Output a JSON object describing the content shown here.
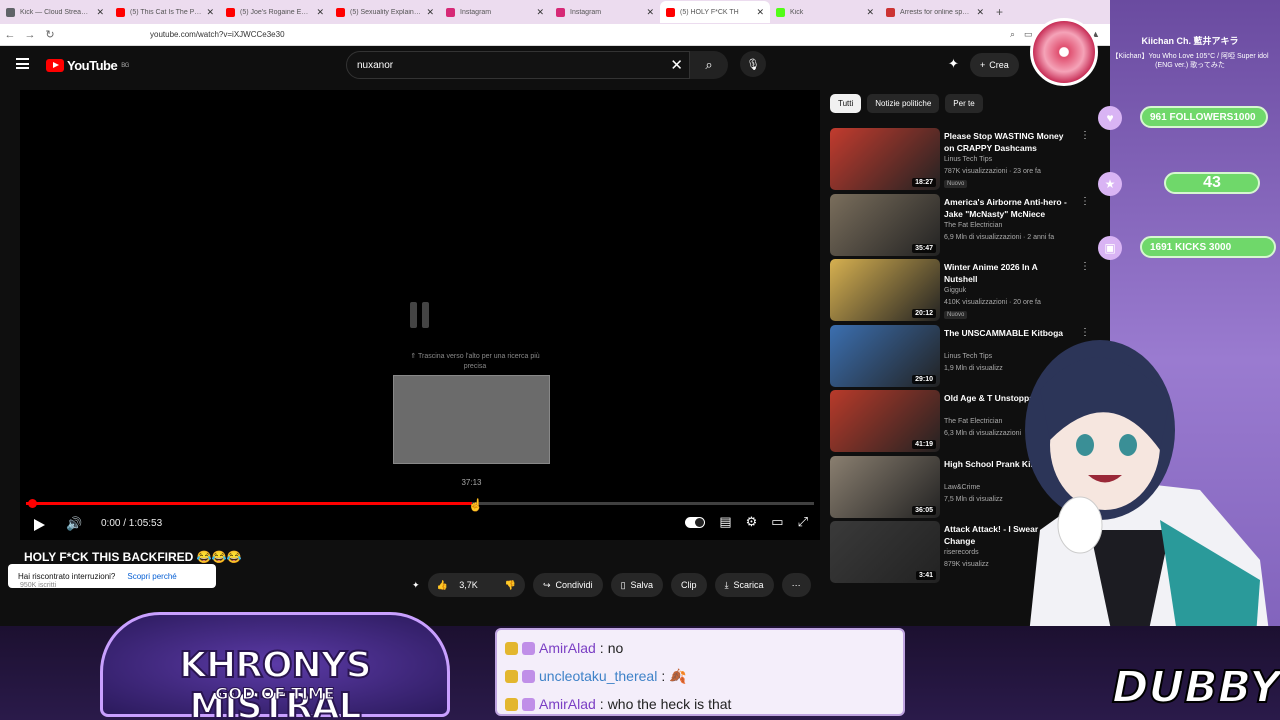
{
  "browser": {
    "tabs": [
      {
        "label": "Kick — Cloud Streaming",
        "color": "#5f6368"
      },
      {
        "label": "(5) This Cat Is The Perfect",
        "color": "#ff0000"
      },
      {
        "label": "(5) Joe's Rogaine Experie",
        "color": "#ff0000"
      },
      {
        "label": "(5) Sexuality Explained wit",
        "color": "#ff0000"
      },
      {
        "label": "Instagram",
        "color": "#d62976"
      },
      {
        "label": "Instagram",
        "color": "#d62976"
      },
      {
        "label": "(5) HOLY F*CK TH",
        "color": "#ff0000"
      },
      {
        "label": "Kick",
        "color": "#53fc18"
      },
      {
        "label": "Arrests for online speech",
        "color": "#cc3333"
      }
    ],
    "url": "youtube.com/watch?v=iXJWCCe3e30"
  },
  "youtube": {
    "logo": "YouTube",
    "region": "BG",
    "search_value": "nuxanor",
    "create_label": "Crea",
    "drag_hint": "⇑ Trascina verso l'alto per una ricerca più precisa",
    "preview_time": "37:13",
    "time": "0:00 / 1:05:53",
    "progress": 0.566,
    "video_title": "HOLY F*CK THIS BACKFIRED 😂😂😂",
    "notice": {
      "text": "Hai riscontrato interruzioni?",
      "link": "Scopri perché"
    },
    "channel_subs": "950K iscritti",
    "actions": {
      "likes": "3,7K",
      "share": "Condividi",
      "save": "Salva",
      "clip": "Clip",
      "download": "Scarica"
    },
    "chips": [
      "Tutti",
      "Notizie politiche",
      "Per te"
    ],
    "recommendations": [
      {
        "title": "Please Stop WASTING Money on CRAPPY Dashcams",
        "channel": "Linus Tech Tips",
        "meta": "787K visualizzazioni · 23 ore fa",
        "badge": "Nuovo",
        "duration": "18:27",
        "thumb": "#c23b2e"
      },
      {
        "title": "America's Airborne Anti-hero - Jake \"McNasty\" McNiece",
        "channel": "The Fat Electrician",
        "meta": "6,9 Mln di visualizzazioni · 2 anni fa",
        "badge": "",
        "duration": "35:47",
        "thumb": "#7a6e5c"
      },
      {
        "title": "Winter Anime 2026 In A Nutshell",
        "channel": "Gigguk",
        "meta": "410K visualizzazioni · 20 ore fa",
        "badge": "Nuovo",
        "duration": "20:12",
        "thumb": "#d6b050"
      },
      {
        "title": "The UNSCAMMABLE Kitboga",
        "channel": "Linus Tech Tips",
        "meta": "1,9 Mln di visualizz",
        "badge": "",
        "duration": "29:10",
        "thumb": "#3b6fb0"
      },
      {
        "title": "Old Age & T Unstoppab",
        "channel": "The Fat Electrician",
        "meta": "6,3 Mln di visualizzazioni",
        "badge": "",
        "duration": "41:19",
        "thumb": "#b83a2a"
      },
      {
        "title": "High School Prank Kin Four",
        "channel": "Law&Crime",
        "meta": "7,5 Mln di visualizz",
        "badge": "",
        "duration": "36:05",
        "thumb": "#8a7f70"
      },
      {
        "title": "Attack Attack! - I Swear Change",
        "channel": "riserecords",
        "meta": "879K visualizz",
        "badge": "",
        "duration": "3:41",
        "thumb": "#3a3a3a"
      }
    ]
  },
  "stream": {
    "now_playing_title": "Kiichan Ch. 藍井アキラ",
    "now_playing_sub": "【Kiichan】You Who Love 105°C / 阿啞 Super idol (ENG ver.) 歌ってみた",
    "goals": [
      {
        "label": "961  FOLLOWERS1000",
        "icon": "♥"
      },
      {
        "label": "43",
        "icon": "★"
      },
      {
        "label": "1691     KICKS     3000",
        "icon": "▣"
      }
    ],
    "logo_title": "KHRONYS MISTRAL",
    "logo_sub": "GOD OF TIME",
    "brand": "DUBBY",
    "chat": [
      {
        "user": "AmirAlad",
        "text": "no",
        "style": "usr"
      },
      {
        "user": "uncleotaku_thereal",
        "text": "🍂",
        "style": "usr2"
      },
      {
        "user": "AmirAlad",
        "text": "who the heck is that",
        "style": "usr"
      }
    ]
  }
}
